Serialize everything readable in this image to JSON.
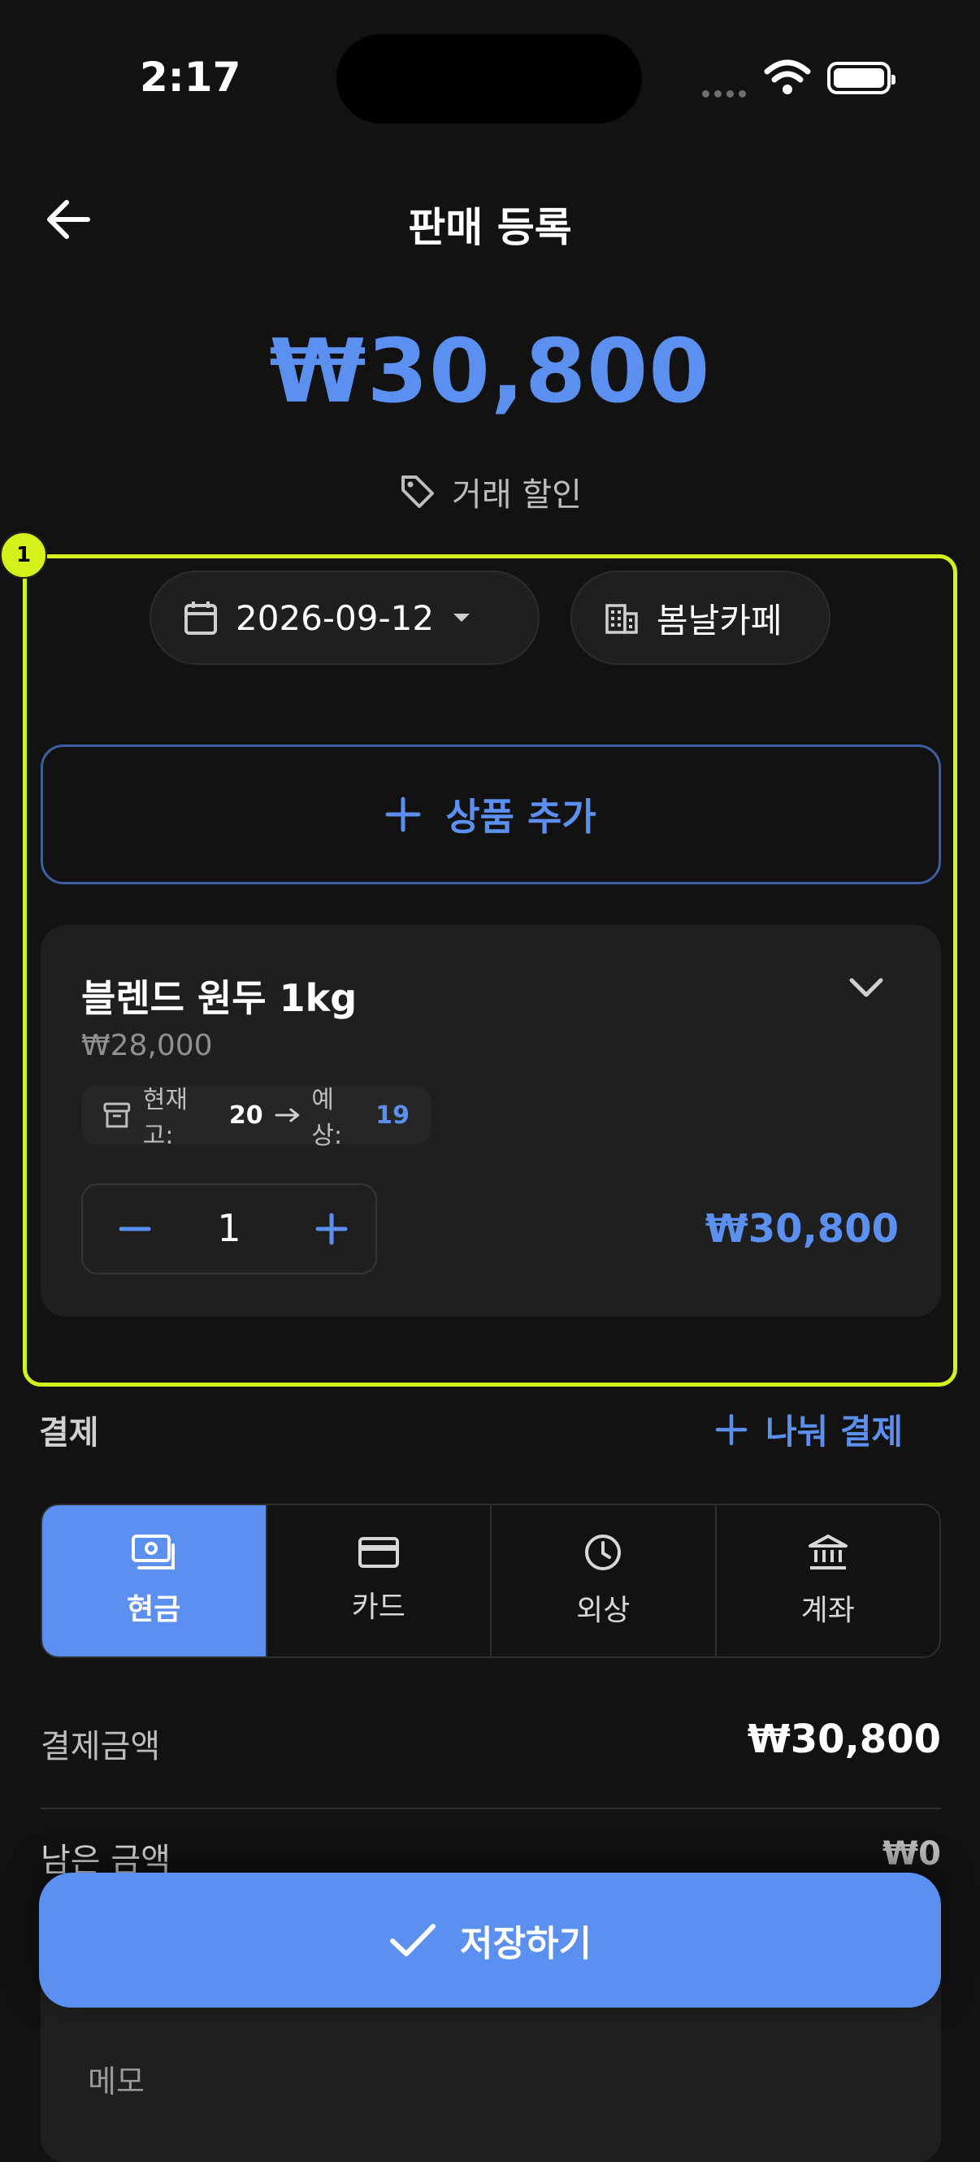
{
  "status_bar": {
    "time": "2:17"
  },
  "header": {
    "title": "판매 등록"
  },
  "total_amount": "₩30,800",
  "discount_label": "거래 할인",
  "overlay_badge": "1",
  "filters": {
    "date": "2026-09-12",
    "store": "봄날카페"
  },
  "add_product_label": "상품 추가",
  "product": {
    "name": "블렌드 원두 1kg",
    "unit_price": "₩28,000",
    "stock_label": "현재고:",
    "stock_current": "20",
    "stock_expected_label": "예상:",
    "stock_expected": "19",
    "quantity": "1",
    "line_total": "₩30,800"
  },
  "payment": {
    "title": "결제",
    "split_label": "나눠 결제",
    "methods": [
      {
        "label": "현금",
        "icon": "cash-icon",
        "active": true
      },
      {
        "label": "카드",
        "icon": "card-icon",
        "active": false
      },
      {
        "label": "외상",
        "icon": "clock-icon",
        "active": false
      },
      {
        "label": "계좌",
        "icon": "bank-icon",
        "active": false
      }
    ],
    "amount_label": "결제금액",
    "amount_value": "₩30,800",
    "remaining_label": "남은 금액",
    "remaining_value": "₩0"
  },
  "memo_label": "메모",
  "save_label": "저장하기",
  "colors": {
    "accent": "#5b8ff0",
    "highlight": "#d4f21a",
    "background": "#121212"
  }
}
